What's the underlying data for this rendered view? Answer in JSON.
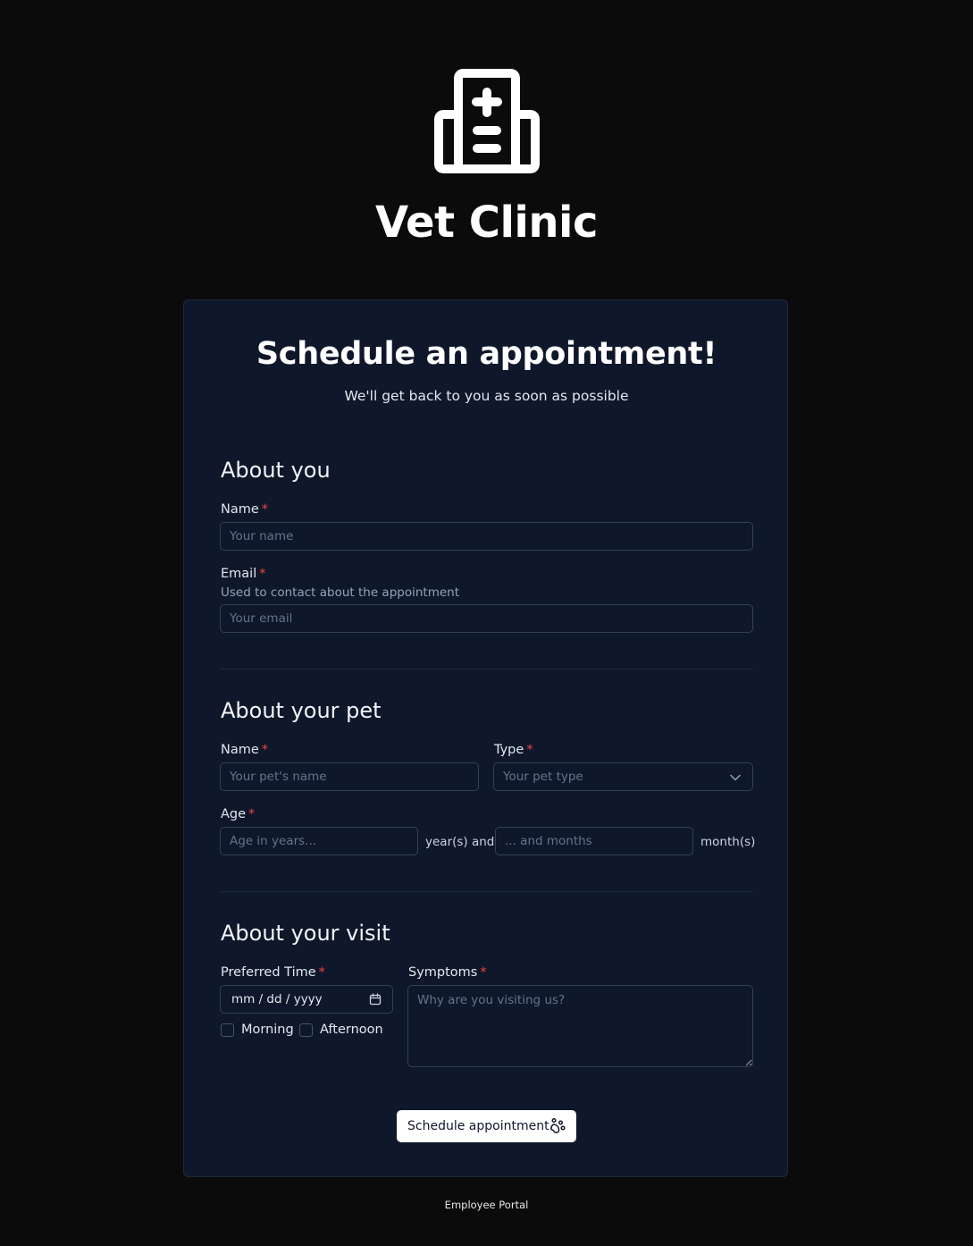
{
  "brand": {
    "logo_icon": "hospital-icon",
    "name": "Vet Clinic"
  },
  "form": {
    "title": "Schedule an appointment!",
    "subtitle": "We'll get back to you as soon as possible",
    "required_marker": "*",
    "about_you": {
      "title": "About you",
      "name_label": "Name",
      "name_placeholder": "Your name",
      "email_label": "Email",
      "email_helper": "Used to contact about the appointment",
      "email_placeholder": "Your email"
    },
    "about_pet": {
      "title": "About your pet",
      "name_label": "Name",
      "name_placeholder": "Your pet's name",
      "type_label": "Type",
      "type_placeholder": "Your pet type",
      "age_label": "Age",
      "years_placeholder": "Age in years...",
      "years_suffix": "year(s) and",
      "months_placeholder": "... and months",
      "months_suffix": "month(s)"
    },
    "about_visit": {
      "title": "About your visit",
      "time_label": "Preferred Time",
      "date_placeholder": "mm / dd / yyyy",
      "morning_label": "Morning",
      "afternoon_label": "Afternoon",
      "symptoms_label": "Symptoms",
      "symptoms_placeholder": "Why are you visiting us?"
    },
    "submit_label": "Schedule appointment",
    "submit_icon": "paw-icon"
  },
  "footer": {
    "link_label": "Employee Portal"
  },
  "colors": {
    "page_bg": "#0b0b0b",
    "card_bg": "#0f172a",
    "required": "#ef4444",
    "button_bg": "#ffffff"
  }
}
